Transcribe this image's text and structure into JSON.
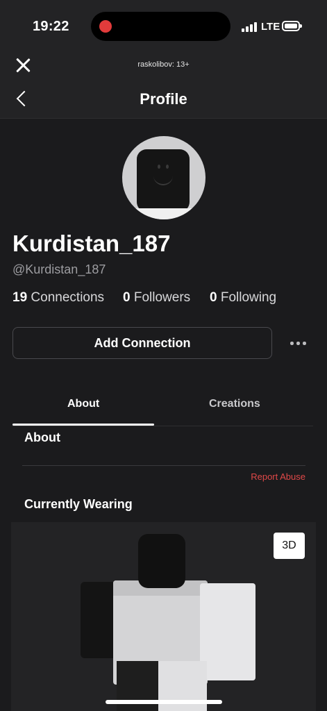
{
  "status_bar": {
    "time": "19:22",
    "network": "LTE"
  },
  "browser_bar": {
    "title": "raskolibov: 13+"
  },
  "header": {
    "title": "Profile"
  },
  "profile": {
    "display_name": "Kurdistan_187",
    "username": "@Kurdistan_187",
    "stats": [
      {
        "count": "19",
        "label": "Connections"
      },
      {
        "count": "0",
        "label": "Followers"
      },
      {
        "count": "0",
        "label": "Following"
      }
    ],
    "add_button": "Add Connection"
  },
  "tabs": [
    {
      "label": "About",
      "active": true
    },
    {
      "label": "Creations",
      "active": false
    }
  ],
  "about": {
    "heading": "About",
    "report_link": "Report Abuse",
    "report_color": "#e04848"
  },
  "wearing": {
    "heading": "Currently Wearing",
    "view_button": "3D"
  },
  "icons": {
    "close": "close-icon",
    "back": "chevron-left-icon",
    "more": "more-horizontal-icon",
    "recording": "recording-dot-icon"
  }
}
